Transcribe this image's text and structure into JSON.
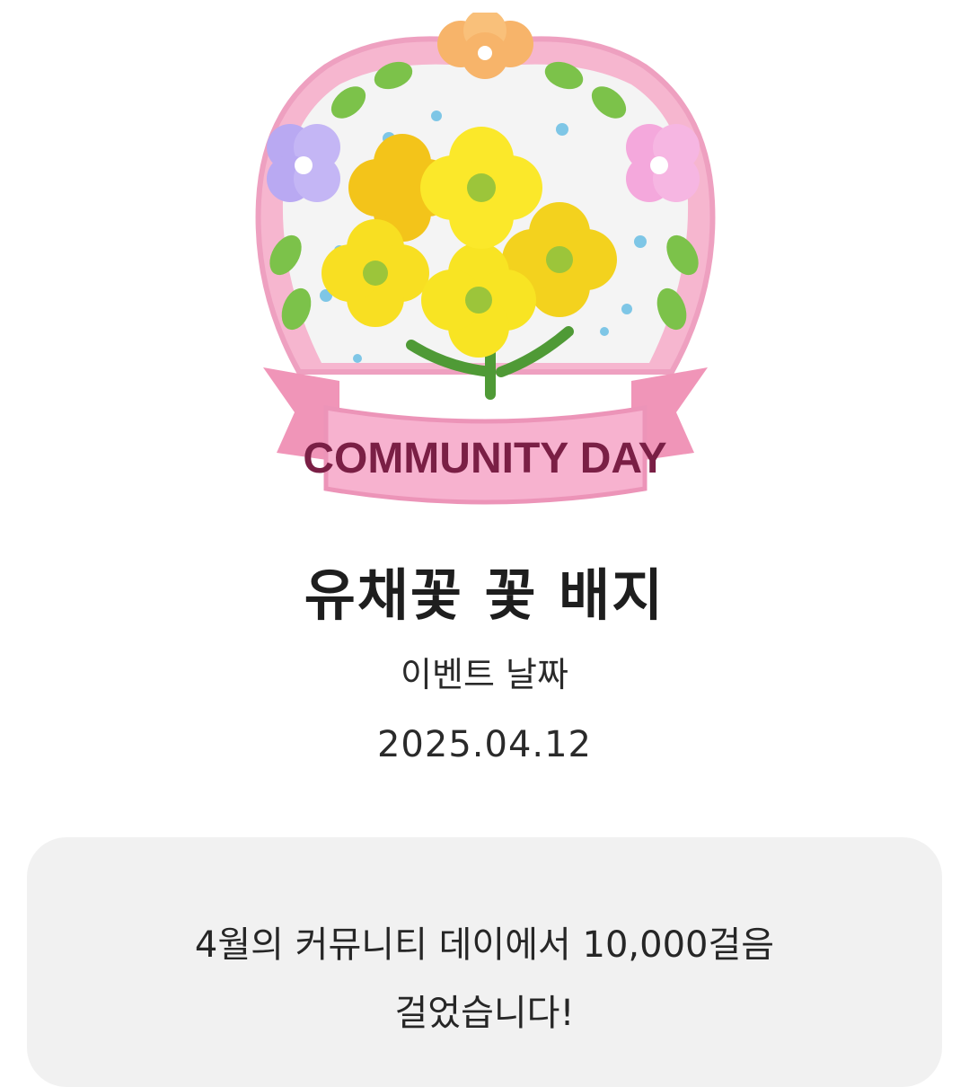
{
  "badge": {
    "ribbon_text": "COMMUNITY DAY",
    "name": "유채꽃 꽃 배지"
  },
  "event": {
    "date_label": "이벤트 날짜",
    "date_value": "2025.04.12"
  },
  "description": {
    "line1": "4월의 커뮤니티 데이에서 10,000걸음",
    "line2": "걸었습니다!"
  },
  "colors": {
    "background": "#ffffff",
    "card": "#f1f1f1",
    "ribbon": "#f4a8c8",
    "ribbon_text": "#7a1f45",
    "petal_yellow": "#f7e21c",
    "frame_pink": "#f6b6cf"
  }
}
